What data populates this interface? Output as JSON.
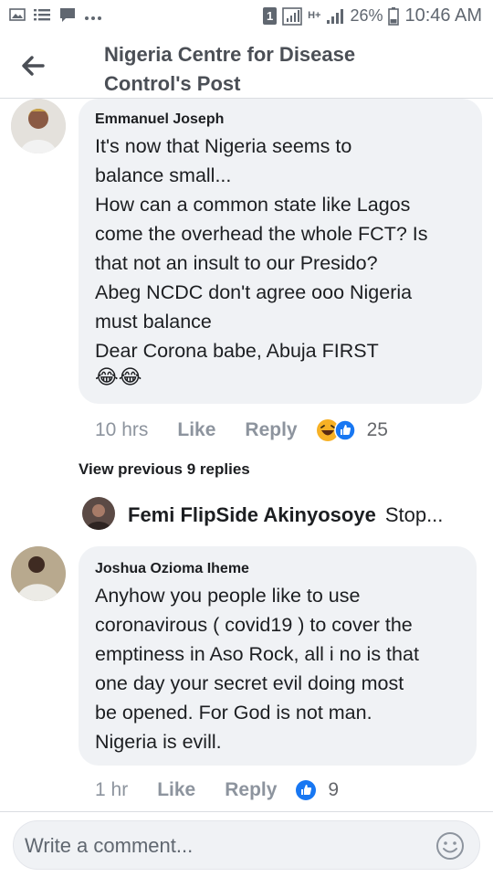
{
  "status_bar": {
    "time": "10:46 AM",
    "battery_percent": "26%",
    "network": "H+",
    "sim_badge": "1",
    "notification_icons": [
      "image-icon",
      "list-icon",
      "chat-icon",
      "more-dots-icon"
    ]
  },
  "header": {
    "title": "Nigeria Centre for Disease Control's Post"
  },
  "comments": [
    {
      "author": "Emmanuel Joseph",
      "text": "It's now that Nigeria seems to\nbalance small...\nHow can a common state like Lagos\ncome the overhead the whole FCT? Is\nthat not an insult to our Presido?\nAbeg  NCDC don't agree ooo Nigeria\nmust balance\nDear Corona babe, Abuja FIRST",
      "emoji": "😂😂",
      "time": "10 hrs",
      "like_label": "Like",
      "reply_label": "Reply",
      "reactions": [
        "haha",
        "like"
      ],
      "reaction_count": "25",
      "view_previous": "View previous 9 replies",
      "reply_preview": {
        "author": "Femi FlipSide Akinyosoye",
        "text": "Stop..."
      }
    },
    {
      "author": "Joshua Ozioma Iheme",
      "text": "Anyhow you people like to use\ncoronavirous ( covid19 ) to cover the\nemptiness in Aso Rock, all i no is that\none day your secret evil doing most\nbe opened. For God is not man.\nNigeria is evill.",
      "time": "1 hr",
      "like_label": "Like",
      "reply_label": "Reply",
      "reactions": [
        "like"
      ],
      "reaction_count": "9"
    }
  ],
  "composer": {
    "placeholder": "Write a comment..."
  },
  "colors": {
    "bubble": "#f0f2f5",
    "meta_text": "#8d949e",
    "like_blue": "#1877f2",
    "haha_yellow": "#f7b125"
  }
}
